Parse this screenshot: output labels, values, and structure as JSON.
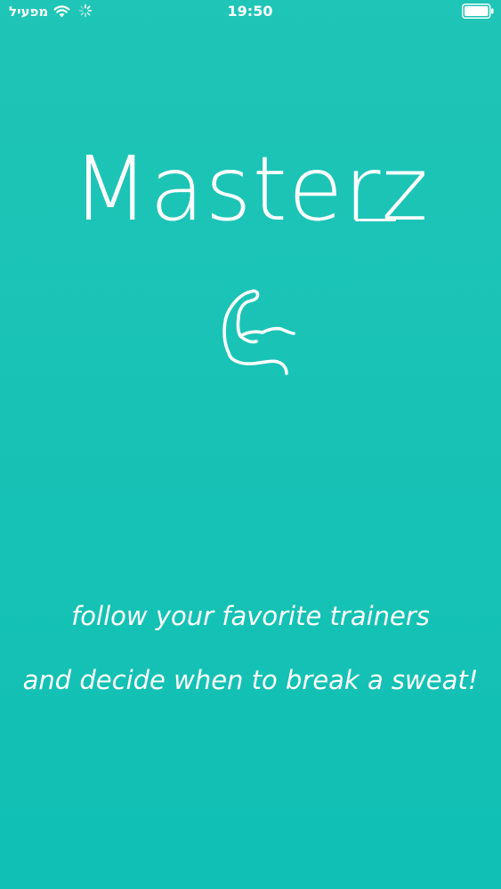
{
  "colors": {
    "background_top": "#1fc5b6",
    "background_bottom": "#10c0b4",
    "foreground": "#ffffff"
  },
  "status_bar": {
    "carrier": "מפעיל",
    "time": "19:50",
    "icons": [
      "wifi-icon",
      "activity-spinner-icon",
      "battery-icon"
    ]
  },
  "splash": {
    "title": "Masterz",
    "logo_icon": "flexed-biceps-icon",
    "tagline_line1": "follow your favorite trainers",
    "tagline_line2": "and decide when to break a sweat!"
  }
}
